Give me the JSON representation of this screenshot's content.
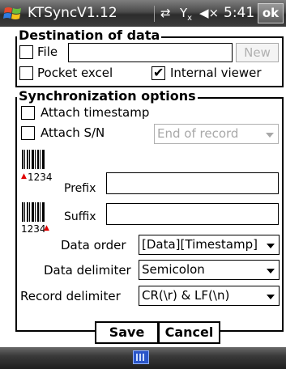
{
  "titlebar": {
    "app_title": "KTSyncV1.12",
    "time": "5:41",
    "ok_label": "ok",
    "icons": [
      "windows-logo-icon",
      "connectivity-icon",
      "signal-icon",
      "volume-muted-icon"
    ]
  },
  "destination": {
    "legend": "Destination of data",
    "file_label": "File",
    "file_checked": false,
    "file_value": "",
    "new_label": "New",
    "pocket_excel_label": "Pocket excel",
    "pocket_excel_checked": false,
    "internal_viewer_label": "Internal viewer",
    "internal_viewer_checked": true
  },
  "sync": {
    "legend": "Synchronization options",
    "attach_timestamp_label": "Attach timestamp",
    "attach_timestamp_checked": false,
    "attach_sn_label": "Attach S/N",
    "attach_sn_checked": false,
    "sn_position": "End of record",
    "barcode_text": "1234",
    "prefix_label": "Prefix",
    "prefix_value": "",
    "suffix_label": "Suffix",
    "suffix_value": "",
    "data_order_label": "Data order",
    "data_order_value": "[Data][Timestamp]",
    "data_delimiter_label": "Data delimiter",
    "data_delimiter_value": "Semicolon",
    "record_delimiter_label": "Record delimiter",
    "record_delimiter_value": "CR(\\r) & LF(\\n)"
  },
  "buttons": {
    "save_label": "Save",
    "cancel_label": "Cancel"
  },
  "colors": {
    "marker_red": "#e00000",
    "taskbar_dark": "#2c2c2c",
    "keyboard_blue": "#2a55c8"
  }
}
